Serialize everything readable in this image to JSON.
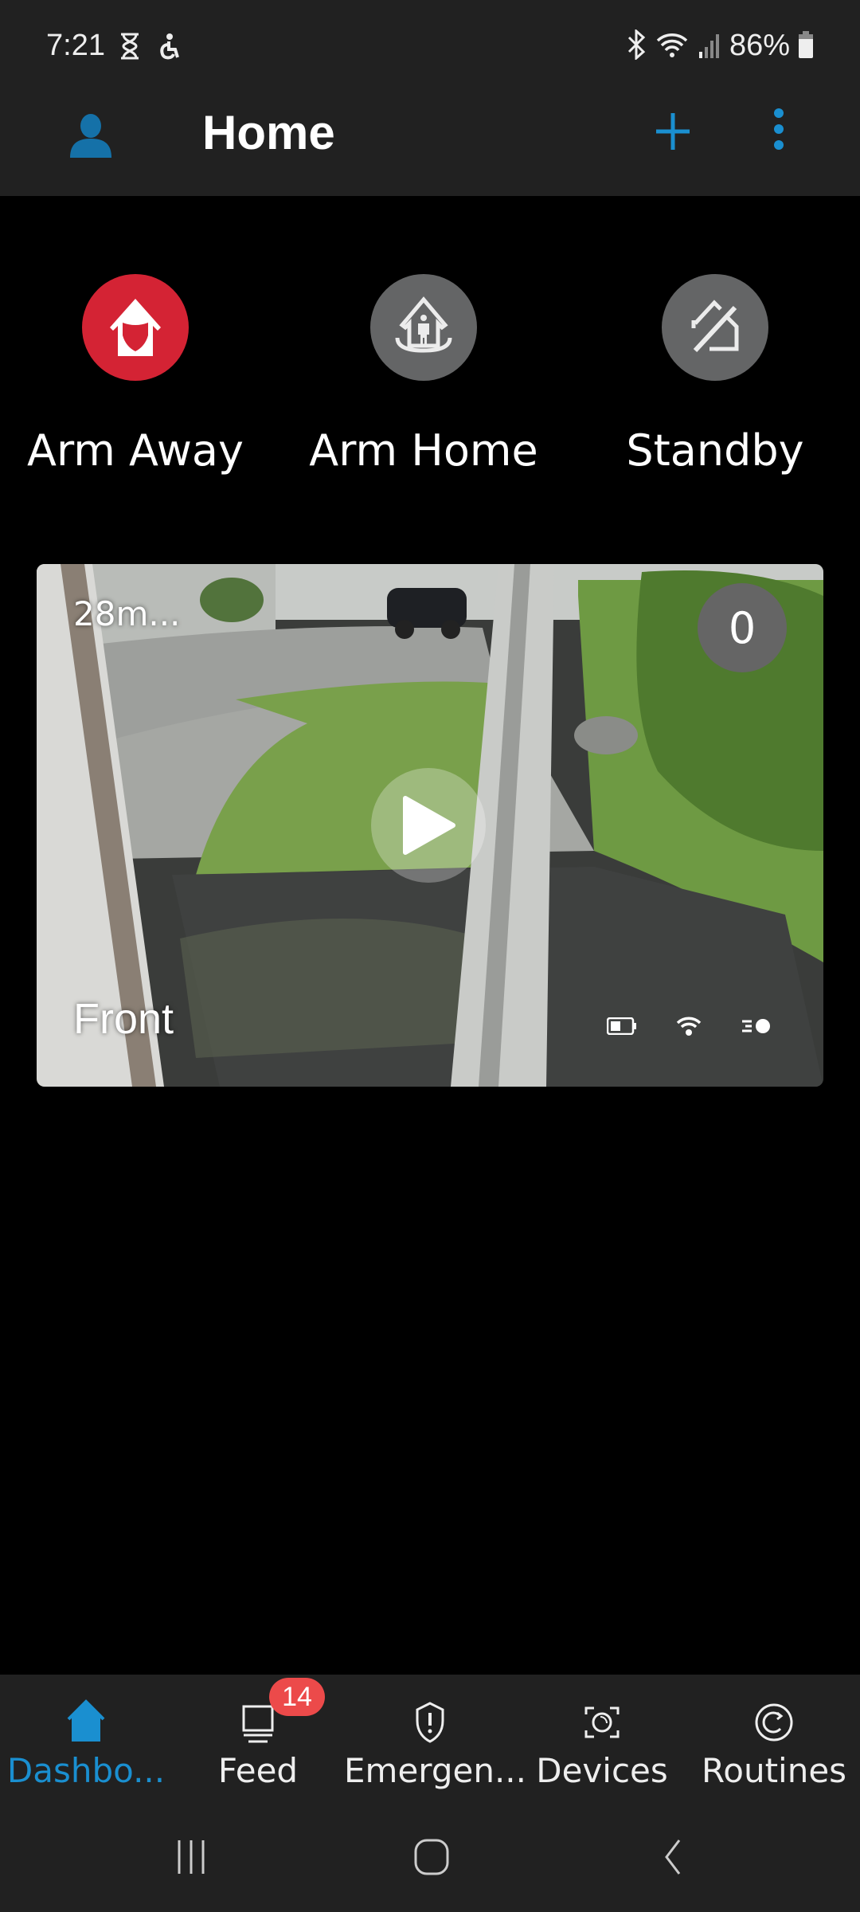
{
  "status_bar": {
    "time": "7:21",
    "left_icons": [
      "hourglass-icon",
      "accessibility-icon"
    ],
    "right_icons": [
      "bluetooth-icon",
      "wifi-icon",
      "signal-icon"
    ],
    "battery_percent": "86%"
  },
  "app_bar": {
    "title": "Home",
    "profile_icon": "person-icon",
    "add_icon": "plus-icon",
    "more_icon": "more-vert-icon",
    "accent_color": "#1a8fd0"
  },
  "modes": [
    {
      "label": "Arm Away",
      "icon": "shield-house-icon",
      "active": true,
      "color": "#d42334"
    },
    {
      "label": "Arm Home",
      "icon": "person-house-icon",
      "active": false,
      "color": "#646566"
    },
    {
      "label": "Standby",
      "icon": "house-slash-icon",
      "active": false,
      "color": "#646566"
    }
  ],
  "camera": {
    "name": "Front",
    "last_event": "28m...",
    "event_count": "0",
    "status_icons": [
      "battery-icon",
      "wifi-icon",
      "motion-light-icon"
    ]
  },
  "bottom_nav": {
    "items": [
      {
        "label": "Dashbo...",
        "icon": "home-icon",
        "active": true
      },
      {
        "label": "Feed",
        "icon": "feed-icon",
        "active": false
      },
      {
        "label": "Emergen...",
        "icon": "shield-alert-icon",
        "active": false
      },
      {
        "label": "Devices",
        "icon": "camera-device-icon",
        "active": false
      },
      {
        "label": "Routines",
        "icon": "routine-icon",
        "active": false
      }
    ],
    "feed_badge": "14",
    "badge_color": "#ec4a4a"
  },
  "system_nav": {
    "buttons": [
      "recents-button",
      "home-button",
      "back-button"
    ]
  }
}
